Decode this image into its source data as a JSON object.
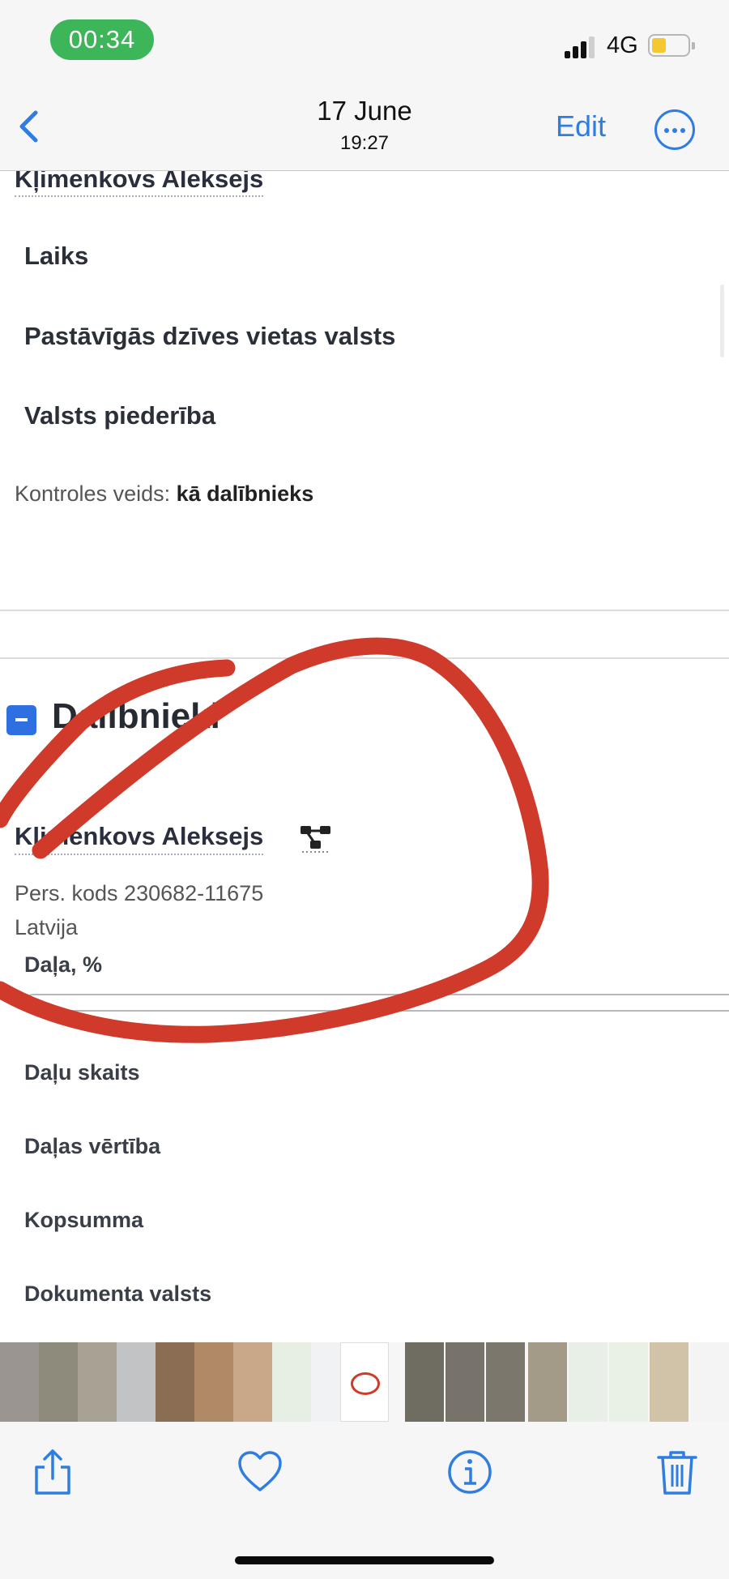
{
  "status_bar": {
    "time": "00:34",
    "network": "4G",
    "colors": {
      "time_pill": "#3db65a",
      "battery": "#f3c830"
    }
  },
  "nav_bar": {
    "date": "17 June",
    "time": "19:27",
    "edit_label": "Edit",
    "accent_color": "#2f7de1",
    "icons": [
      "chevron-left-icon",
      "ellipsis-circle-icon"
    ]
  },
  "document": {
    "top_name": "Kļimenkovs Aleksejs",
    "fields_top": [
      "Laiks",
      "Pastāvīgās dzīves vietas valsts",
      "Valsts piederība"
    ],
    "control_type_label": "Kontroles veids:",
    "control_type_value": "kā dalībnieks",
    "section_title": "Dalībnieki",
    "member": {
      "name": "Kļimenkovs Aleksejs",
      "code": "Pers. kods 230682-11675",
      "country": "Latvija"
    },
    "fields_bottom": [
      "Daļa, %",
      "Daļu skaits",
      "Daļas vērtība",
      "Kopsumma",
      "Dokumenta valsts"
    ],
    "toggle_color": "#2e6fe2",
    "annotation_color": "#d03a2b"
  },
  "toolbar": {
    "icons": [
      "share-icon",
      "heart-icon",
      "info-icon",
      "trash-icon"
    ]
  }
}
